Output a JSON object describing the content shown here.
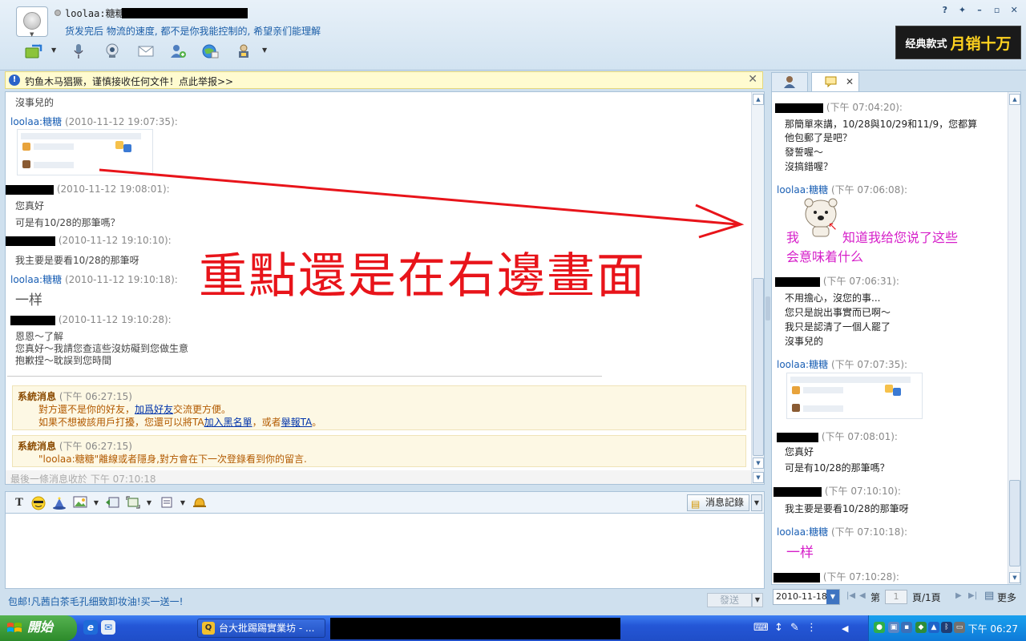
{
  "header": {
    "username": "loolaa:糖糖",
    "signature": "货发完后 物流的速度, 都不是你我能控制的, 希望亲们能理解",
    "ad_banner": {
      "part1": "经典款式",
      "part2": "月销十万"
    },
    "window_controls": [
      "?",
      "✦",
      "–",
      "▫",
      "✕"
    ]
  },
  "warning": {
    "text": "钓鱼木马猖獗，谨慎接收任何文件！点此举报>>",
    "close": "✕"
  },
  "chat": {
    "messages": [
      {
        "text": "沒事兒的"
      },
      {
        "sender": "loolaa:糖糖",
        "time": "(2010-11-12 19:07:35):"
      },
      {
        "time": "(2010-11-12 19:08:01):",
        "lines": [
          "您真好",
          "可是有10/28的那筆嗎？"
        ]
      },
      {
        "time": "(2010-11-12 19:10:10):",
        "lines": [
          "我主要是要看10/28的那筆呀"
        ]
      },
      {
        "sender": "loolaa:糖糖",
        "time": "(2010-11-12 19:10:18):",
        "lines": [
          "一样"
        ]
      },
      {
        "time": "(2010-11-12 19:10:28):",
        "lines": [
          "恩恩～了解",
          "您真好～我請您查這些沒妨礙到您做生意",
          "抱歉捏～耽誤到您時間"
        ]
      }
    ],
    "system1": {
      "title": "系統消息",
      "time": "(下午 06:27:15)",
      "line1_pre": "對方還不是你的好友，",
      "line1_link": "加爲好友",
      "line1_post": "交流更方便。",
      "line2_pre": "如果不想被該用戶打擾，您還可以將TA",
      "line2_link1": "加入黑名單",
      "line2_mid": "，或者",
      "line2_link2": "舉報TA",
      "line2_post": "。"
    },
    "system2": {
      "title": "系統消息",
      "time": "(下午 06:27:15)",
      "body": "\"loolaa:糖糖\"離線或者隱身,對方會在下一次登錄看到你的留言."
    },
    "last_received": "最後一條消息收於  下午 07:10:18"
  },
  "annotation": {
    "text": "重點還是在右邊畫面"
  },
  "input": {
    "history_label": "消息記錄",
    "footer_ad": "包邮!凡茜白茶毛孔细致卸妆油!买一送一!",
    "send_label": "發送"
  },
  "right_panel": {
    "messages": [
      {
        "time": "(下午 07:04:20):",
        "lines": [
          "那簡單來講，10/28與10/29和11/9，您都算",
          "他包郵了是吧？",
          "發誓喔～",
          "沒搞錯喔？"
        ]
      },
      {
        "sender": "loolaa:糖糖",
        "time": "(下午 07:06:08):",
        "fancy1": "我",
        "fancy2": "知道我给您说了这些",
        "fancy3": "会意味着什么"
      },
      {
        "time": "(下午 07:06:31):",
        "lines": [
          "不用擔心，沒您的事...",
          "您只是說出事實而已啊～",
          "我只是認清了一個人罷了",
          "沒事兒的"
        ]
      },
      {
        "sender": "loolaa:糖糖",
        "time": "(下午 07:07:35):"
      },
      {
        "time": "(下午 07:08:01):",
        "lines": [
          "您真好",
          "可是有10/28的那筆嗎？"
        ]
      },
      {
        "time": "(下午 07:10:10):",
        "lines": [
          "我主要是要看10/28的那筆呀"
        ]
      },
      {
        "sender": "loolaa:糖糖",
        "time": "(下午 07:10:18):",
        "big": "一样"
      },
      {
        "time": "(下午 07:10:28):"
      }
    ],
    "bottom": {
      "date": "2010-11-18",
      "page_prefix": "第",
      "page_value": "1",
      "page_suffix": "頁/1頁",
      "more": "更多"
    }
  },
  "taskbar": {
    "start_label": "開始",
    "task_label": "台大批踢踢實業坊 - ...",
    "clock": "下午 06:27"
  }
}
